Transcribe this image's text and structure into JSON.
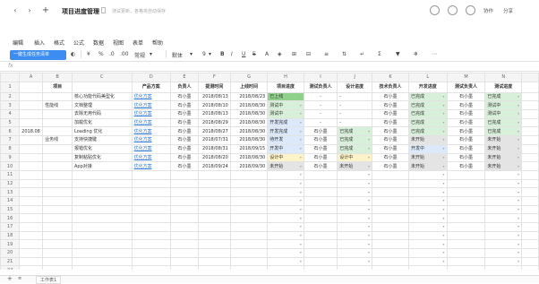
{
  "titlebar": {
    "back": "‹",
    "forward": "›",
    "add": "+",
    "title": "项目进度管理",
    "status": "测试更新，各格将自动保存",
    "collab": "协作",
    "share": "分享"
  },
  "menu": [
    "编辑",
    "插入",
    "格式",
    "公式",
    "数据",
    "视图",
    "表单",
    "帮助"
  ],
  "toolbar": {
    "sheet_pill": "一键生成任务清单",
    "percent": "%",
    "decimal_a": ".0",
    "decimal_b": ".00",
    "format": "常规",
    "font": "默体",
    "size": "9",
    "bold": "B",
    "italic": "I",
    "underline": "U",
    "strike": "S"
  },
  "formula": {
    "fx": "fx"
  },
  "columns": [
    "A",
    "B",
    "C",
    "D",
    "E",
    "F",
    "G",
    "H",
    "I",
    "J",
    "K",
    "L",
    "M",
    "N"
  ],
  "header": [
    "",
    "项目",
    "",
    "产品方案",
    "负责人",
    "提测时间",
    "上线时间",
    "项目进度",
    "测试负责人",
    "设计进度",
    "技术负责人",
    "开发进度",
    "测试负责人",
    "测试进度"
  ],
  "rows": [
    {
      "r": "2",
      "a": "",
      "b": "",
      "c": "核心功能代码美型化",
      "d": "优化方案",
      "e": "石小墨",
      "f": "2018/08/13",
      "g": "2018/08/23",
      "h": "已上线",
      "i": "-",
      "j": "-",
      "k": "石小墨",
      "l": "已完成",
      "m": "石小墨",
      "n": "已完成"
    },
    {
      "r": "3",
      "a": "",
      "b": "性能线",
      "c": "文档整理",
      "d": "优化方案",
      "e": "石小墨",
      "f": "2018/08/10",
      "g": "2018/08/30",
      "h": "测试中",
      "i": "-",
      "j": "-",
      "k": "石小墨",
      "l": "已完成",
      "m": "石小墨",
      "n": "测试中"
    },
    {
      "r": "4",
      "a": "",
      "b": "",
      "c": "去除无用代码",
      "d": "优化方案",
      "e": "石小墨",
      "f": "2018/08/13",
      "g": "2018/08/30",
      "h": "测试中",
      "i": "-",
      "j": "-",
      "k": "石小墨",
      "l": "已完成",
      "m": "石小墨",
      "n": "测试中"
    },
    {
      "r": "5",
      "a": "",
      "b": "",
      "c": "加载优化",
      "d": "优化方案",
      "e": "石小墨",
      "f": "2018/08/29",
      "g": "2018/08/30",
      "h": "开发完成",
      "i": "-",
      "j": "-",
      "k": "石小墨",
      "l": "已完成",
      "m": "石小墨",
      "n": "已完成"
    },
    {
      "r": "6",
      "a": "2018.08",
      "b": "",
      "c": "Loading 优化",
      "d": "优化方案",
      "e": "石小墨",
      "f": "2018/08/27",
      "g": "2018/08/30",
      "h": "开发完成",
      "i": "石小墨",
      "j": "已完成",
      "k": "石小墨",
      "l": "已完成",
      "m": "石小墨",
      "n": "已完成"
    },
    {
      "r": "7",
      "a": "",
      "b": "业务线",
      "c": "支持快捷键",
      "d": "优化方案",
      "e": "石小墨",
      "f": "2018/07/31",
      "g": "2018/08/30",
      "h": "待开发",
      "i": "石小墨",
      "j": "已完成",
      "k": "石小墨",
      "l": "未开始",
      "m": "石小墨",
      "n": "未开始"
    },
    {
      "r": "8",
      "a": "",
      "b": "",
      "c": "报错优化",
      "d": "优化方案",
      "e": "石小墨",
      "f": "2018/08/31",
      "g": "2018/09/15",
      "h": "开发中",
      "i": "石小墨",
      "j": "已完成",
      "k": "石小墨",
      "l": "开发中",
      "m": "石小墨",
      "n": "未开始"
    },
    {
      "r": "9",
      "a": "",
      "b": "",
      "c": "复制粘贴优化",
      "d": "优化方案",
      "e": "石小墨",
      "f": "2018/08/20",
      "g": "2018/08/30",
      "h": "设计中",
      "i": "石小墨",
      "j": "设计中",
      "k": "石小墨",
      "l": "未开始",
      "m": "石小墨",
      "n": "未开始"
    },
    {
      "r": "10",
      "a": "",
      "b": "",
      "c": "App对接",
      "d": "优化方案",
      "e": "石小墨",
      "f": "2018/09/24",
      "g": "2018/09/30",
      "h": "未开始",
      "i": "石小墨",
      "j": "未开始",
      "k": "石小墨",
      "l": "未开始",
      "m": "石小墨",
      "n": "未开始"
    }
  ],
  "empty_rows": [
    "11",
    "12",
    "13",
    "14",
    "15",
    "16",
    "17",
    "18",
    "19",
    "20",
    "21",
    "22",
    "23"
  ],
  "bottom": {
    "add": "+",
    "list": "≡",
    "sheet_tab": "工作表1"
  },
  "colors": {
    "accent": "#3b8df1",
    "green": "#d8efd9",
    "blue": "#dbe9fb",
    "yellow": "#fdf3c8",
    "purple": "#ebe3f7",
    "gray": "#e4e4e4"
  }
}
